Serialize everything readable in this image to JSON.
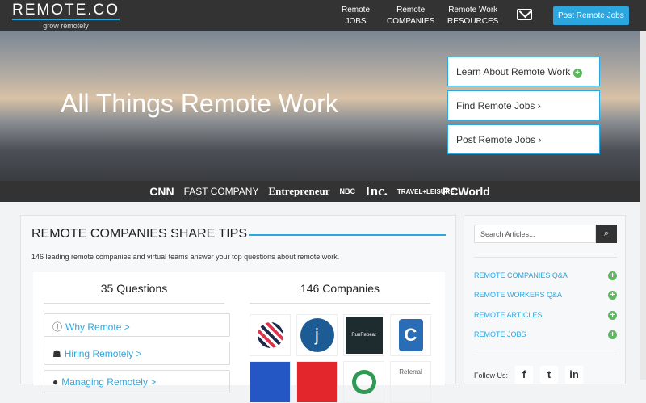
{
  "nav": {
    "logo": "REMOTE.CO",
    "tagline": "grow remotely",
    "links": [
      {
        "l1": "Remote",
        "l2": "JOBS"
      },
      {
        "l1": "Remote",
        "l2": "COMPANIES"
      },
      {
        "l1": "Remote Work",
        "l2": "RESOURCES"
      }
    ],
    "post": "Post Remote Jobs"
  },
  "hero": {
    "title": "All Things Remote Work",
    "buttons": [
      "Learn About Remote Work",
      "Find Remote Jobs",
      "Post Remote Jobs"
    ]
  },
  "press": [
    "CNN",
    "FAST COMPANY",
    "Entrepreneur",
    "NBC",
    "Inc.",
    "TRAVEL+LEISURE",
    "PCWorld"
  ],
  "main": {
    "title": "REMOTE COMPANIES SHARE TIPS",
    "desc": "146 leading remote companies and virtual teams answer your top questions about remote work.",
    "questions_heading": "35 Questions",
    "companies_heading": "146 Companies",
    "questions": [
      "Why Remote >",
      "Hiring Remotely >",
      "Managing Remotely >"
    ],
    "logos": [
      "RunRepeat",
      "Referral"
    ]
  },
  "sidebar": {
    "search_placeholder": "Search Articles...",
    "links": [
      "REMOTE COMPANIES Q&A",
      "REMOTE WORKERS Q&A",
      "REMOTE ARTICLES",
      "REMOTE JOBS"
    ],
    "follow": "Follow Us:",
    "social": [
      "f",
      "t",
      "in"
    ]
  }
}
